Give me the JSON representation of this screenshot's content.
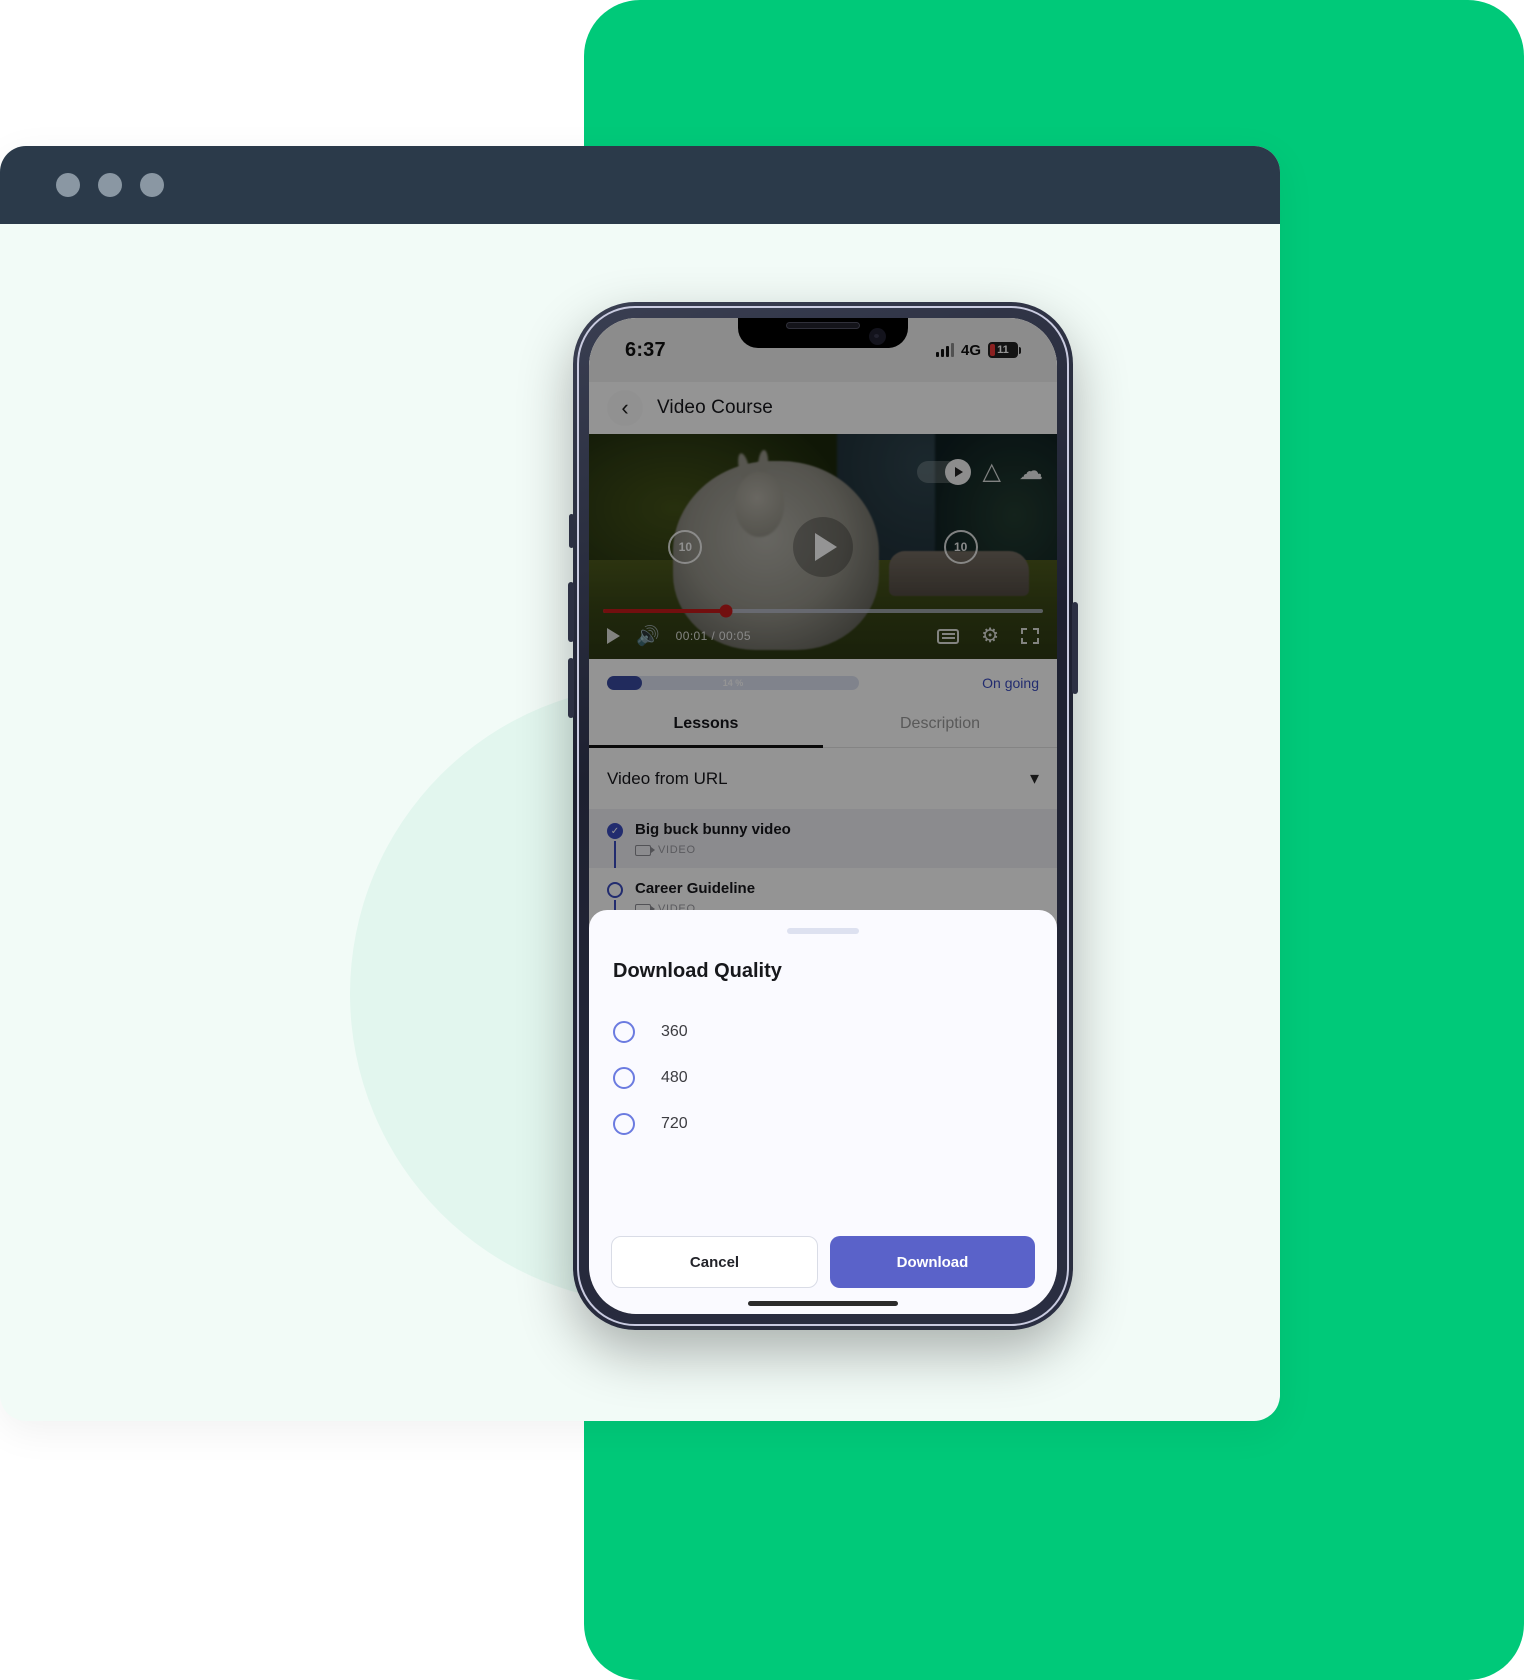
{
  "browser": {
    "dots": [
      "dot-red",
      "dot-yellow",
      "dot-green"
    ]
  },
  "phone": {
    "status_bar": {
      "time": "6:37",
      "network": "4G",
      "battery_percent": "11",
      "signal_icon": "signal-bars-icon",
      "battery_icon": "battery-icon"
    },
    "appbar": {
      "back_icon": "chevron-left-icon",
      "title": "Video Course"
    },
    "video": {
      "pip_icon": "picture-in-picture-icon",
      "airplay_icon": "airplay-icon",
      "download_icon": "cloud-download-icon",
      "rewind_label": "10",
      "forward_label": "10",
      "play_icon": "play-icon",
      "time_display": "00:01 / 00:05",
      "volume_icon": "volume-icon",
      "captions_icon": "closed-captions-icon",
      "settings_icon": "gear-icon",
      "fullscreen_icon": "fullscreen-icon",
      "progress_percent": 28
    },
    "progress": {
      "percent_label": "14 %",
      "fill_percent": 14,
      "status": "On going"
    },
    "tabs": [
      {
        "label": "Lessons",
        "active": true
      },
      {
        "label": "Description",
        "active": false
      }
    ],
    "section": {
      "title": "Video from URL",
      "chevron_icon": "chevron-down-icon"
    },
    "lessons": [
      {
        "title": "Big buck bunny video",
        "type": "VIDEO",
        "completed": true,
        "selected": true
      },
      {
        "title": "Career Guideline",
        "type": "VIDEO",
        "completed": false,
        "selected": false
      }
    ],
    "sheet": {
      "title": "Download Quality",
      "options": [
        {
          "label": "360",
          "selected": false
        },
        {
          "label": "480",
          "selected": false
        },
        {
          "label": "720",
          "selected": false
        }
      ],
      "cancel_label": "Cancel",
      "download_label": "Download"
    }
  },
  "colors": {
    "green_bg": "#00C979",
    "card_bg": "#F2FBF7",
    "browser_bar": "#2B3A4A",
    "accent_indigo": "#3B4CC0",
    "button_indigo": "#5A62C9",
    "video_progress_red": "#C51A1A",
    "battery_red": "#F03A3A"
  }
}
